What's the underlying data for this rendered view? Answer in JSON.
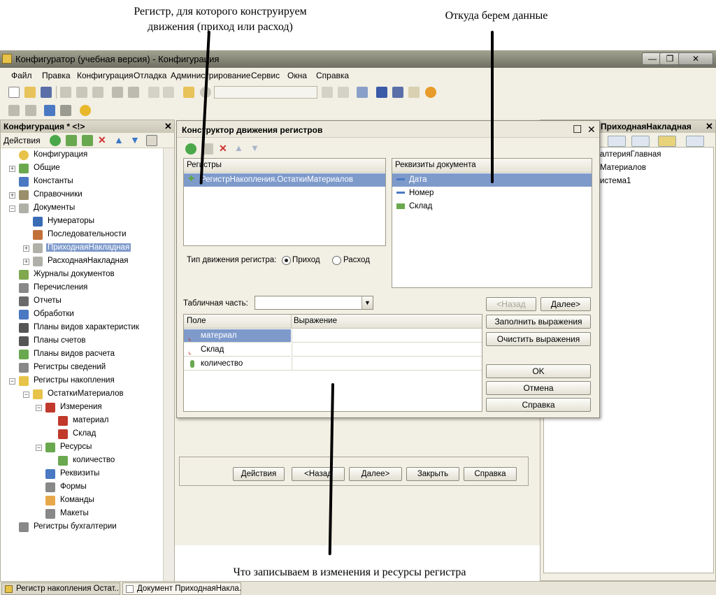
{
  "annotations": {
    "top_left": "Регистр, для которого конструируем движения (приход или расход)",
    "top_right": "Откуда берем данные",
    "bottom": "Что записываем в изменения и ресурсы регистра"
  },
  "window": {
    "title": "Конфигуратор (учебная версия) - Конфигурация",
    "min_glyph": "—",
    "max_glyph": "❐",
    "close_glyph": "✕"
  },
  "menu": [
    "Файл",
    "Правка",
    "Конфигурация",
    "Отладка",
    "Администрирование",
    "Сервис",
    "Окна",
    "Справка"
  ],
  "left_panel": {
    "title": "Конфигурация * <!>",
    "actions_label": "Действия",
    "tree": [
      {
        "label": "Конфигурация",
        "level": 0,
        "expander": "",
        "icon": "#e7c34a"
      },
      {
        "label": "Общие",
        "level": 1,
        "expander": "+",
        "icon": "#6aa84f"
      },
      {
        "label": "Константы",
        "level": 1,
        "expander": "",
        "icon": "#4a78c2"
      },
      {
        "label": "Справочники",
        "level": 1,
        "expander": "+",
        "icon": "#9a8f6a"
      },
      {
        "label": "Документы",
        "level": 1,
        "expander": "−",
        "icon": "#b0b0a8"
      },
      {
        "label": "Нумераторы",
        "level": 2,
        "expander": "",
        "icon": "#3a6bb5"
      },
      {
        "label": "Последовательности",
        "level": 2,
        "expander": "",
        "icon": "#c2703a"
      },
      {
        "label": "ПриходнаяНакладная",
        "level": 2,
        "expander": "+",
        "icon": "#b0b0a8",
        "selected": true
      },
      {
        "label": "РасходнаяНакладная",
        "level": 2,
        "expander": "+",
        "icon": "#b0b0a8"
      },
      {
        "label": "Журналы документов",
        "level": 1,
        "expander": "",
        "icon": "#7fa84f"
      },
      {
        "label": "Перечисления",
        "level": 1,
        "expander": "",
        "icon": "#888"
      },
      {
        "label": "Отчеты",
        "level": 1,
        "expander": "",
        "icon": "#6a6a6a"
      },
      {
        "label": "Обработки",
        "level": 1,
        "expander": "",
        "icon": "#4a78c2"
      },
      {
        "label": "Планы видов характеристик",
        "level": 1,
        "expander": "",
        "icon": "#555"
      },
      {
        "label": "Планы счетов",
        "level": 1,
        "expander": "",
        "icon": "#555"
      },
      {
        "label": "Планы видов расчета",
        "level": 1,
        "expander": "",
        "icon": "#6aa84f"
      },
      {
        "label": "Регистры сведений",
        "level": 1,
        "expander": "",
        "icon": "#888"
      },
      {
        "label": "Регистры накопления",
        "level": 1,
        "expander": "−",
        "icon": "#e7c34a"
      },
      {
        "label": "ОстаткиМатериалов",
        "level": 2,
        "expander": "−",
        "icon": "#e7c34a"
      },
      {
        "label": "Измерения",
        "level": 3,
        "expander": "−",
        "icon": "#c0392b"
      },
      {
        "label": "материал",
        "level": 4,
        "expander": "",
        "icon": "#c0392b"
      },
      {
        "label": "Склад",
        "level": 4,
        "expander": "",
        "icon": "#c0392b"
      },
      {
        "label": "Ресурсы",
        "level": 3,
        "expander": "−",
        "icon": "#6aa84f"
      },
      {
        "label": "количество",
        "level": 4,
        "expander": "",
        "icon": "#6aa84f"
      },
      {
        "label": "Реквизиты",
        "level": 3,
        "expander": "",
        "icon": "#4a78c2"
      },
      {
        "label": "Формы",
        "level": 3,
        "expander": "",
        "icon": "#888"
      },
      {
        "label": "Команды",
        "level": 3,
        "expander": "",
        "icon": "#e7a84a"
      },
      {
        "label": "Макеты",
        "level": 3,
        "expander": "",
        "icon": "#888"
      },
      {
        "label": "Регистры бухгалтерии",
        "level": 1,
        "expander": "",
        "icon": "#888"
      }
    ]
  },
  "right_panel": {
    "title": "ПриходнаяНакладная",
    "items": [
      "алтерияГлавная",
      "Материалов",
      "истема1"
    ]
  },
  "taskbar": [
    {
      "label": "Регистр накопления Остат..."
    },
    {
      "label": "Документ ПриходнаяНакла..."
    }
  ],
  "bg_dialog_buttons": [
    "Действия",
    "<Назад",
    "Далее>",
    "Закрыть",
    "Справка"
  ],
  "dialog": {
    "title": "Конструктор движения регистров",
    "registers_header": "Регистры",
    "registers": [
      "РегистрНакопления.ОстаткиМатериалов"
    ],
    "doc_attrs_header": "Реквизиты документа",
    "doc_attrs": [
      {
        "label": "Дата",
        "selected": true
      },
      {
        "label": "Номер",
        "selected": false
      },
      {
        "label": "Склад",
        "selected": false
      }
    ],
    "movement_type_label": "Тип движения регистра:",
    "radio_income": "Приход",
    "radio_expense": "Расход",
    "movement_type_value": "Приход",
    "tabular_label": "Табличная часть:",
    "tabular_value": "",
    "grid_headers": [
      "Поле",
      "Выражение"
    ],
    "grid_rows": [
      {
        "field": "материал",
        "expr": "",
        "selected": true
      },
      {
        "field": "Склад",
        "expr": "",
        "selected": false
      },
      {
        "field": "количество",
        "expr": "",
        "selected": false
      }
    ],
    "btn_back": "<Назад",
    "btn_next": "Далее>",
    "btn_fill": "Заполнить выражения",
    "btn_clear": "Очистить выражения",
    "btn_ok": "OK",
    "btn_cancel": "Отмена",
    "btn_help": "Справка",
    "close_glyph": "✕",
    "max_glyph": "☐"
  }
}
